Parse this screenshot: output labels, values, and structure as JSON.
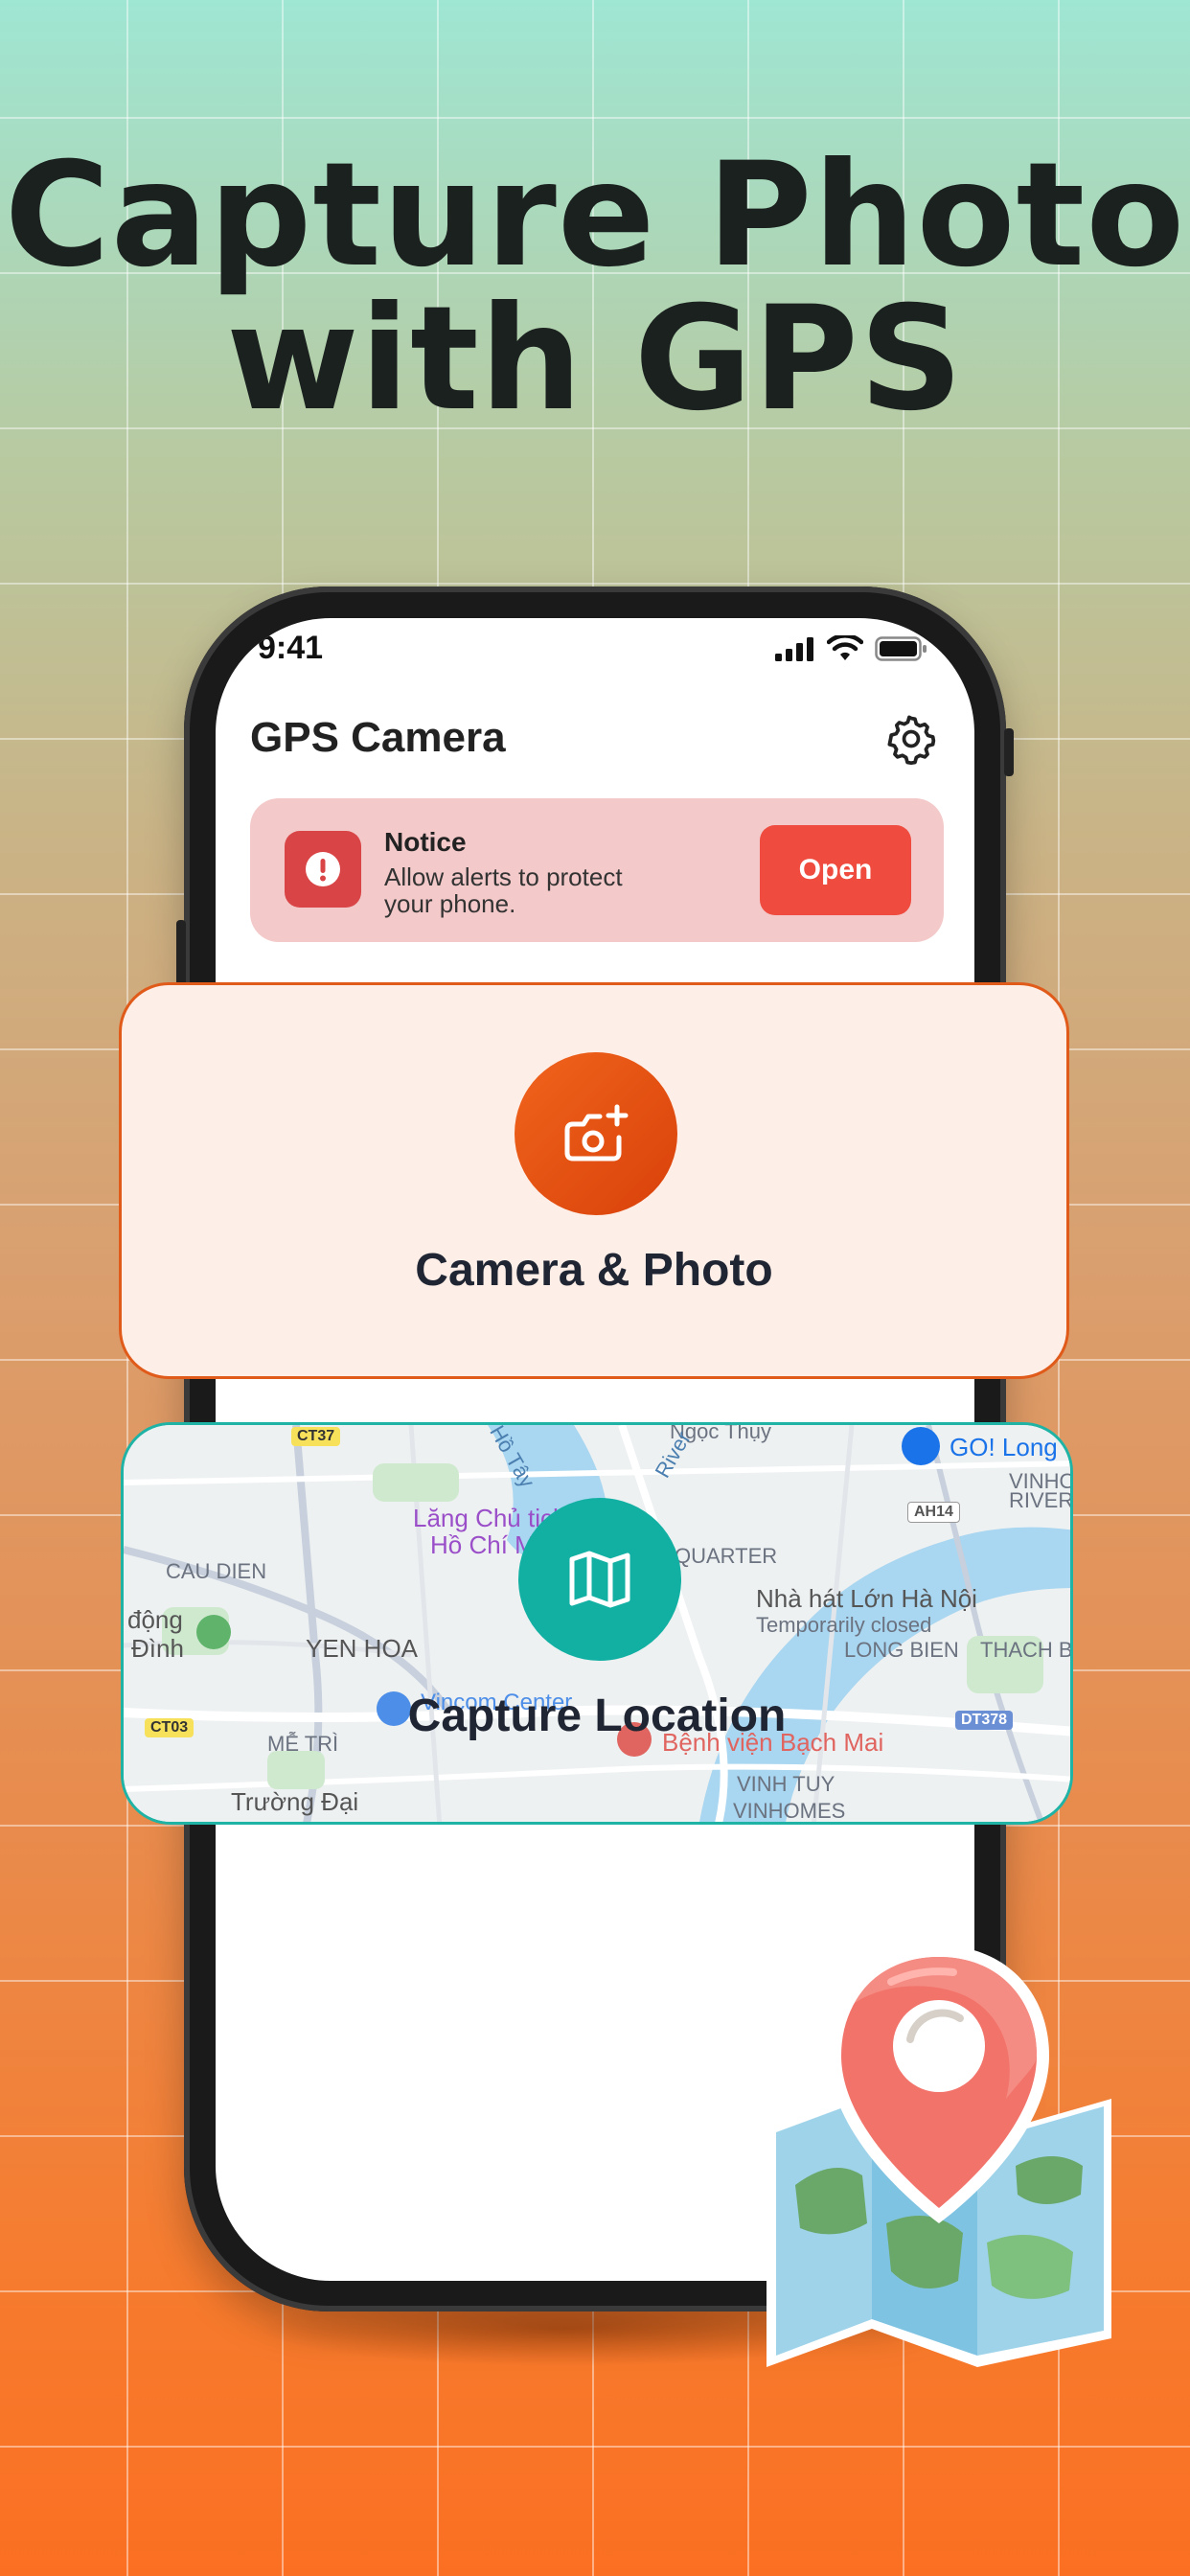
{
  "headline": {
    "line1": "Capture Photo",
    "line2": "with GPS"
  },
  "status_bar": {
    "time": "9:41"
  },
  "app": {
    "title": "GPS Camera"
  },
  "notice": {
    "title": "Notice",
    "text": "Allow alerts to protect your phone.",
    "button": "Open"
  },
  "cards": {
    "camera": {
      "label": "Camera & Photo"
    },
    "location": {
      "label": "Capture Location"
    }
  },
  "map_labels": {
    "l1": "CT37",
    "l2": "Hồ Tây",
    "l3": "Lăng Chủ tịch",
    "l4": "Hồ Chí Minh",
    "l5": "CAU DIEN",
    "l6": "động",
    "l7": "Đình",
    "l8": "YEN HOA",
    "l9": "Vincom Center",
    "l10": "MỄ TRÌ",
    "l11": "Trường Đại",
    "l12": "CT03",
    "l13": "QUARTER",
    "l14": "Nhà hát Lớn Hà Nội",
    "l15": "Temporarily closed",
    "l16": "LONG BIEN",
    "l17": "Bệnh viện Bạch Mai",
    "l18": "VINH TUY",
    "l19": "VINHOMES",
    "l20": "GO! Long",
    "l21": "AH14",
    "l22": "VINHO",
    "l23": "RIVERS",
    "l24": "THACH BA",
    "l25": "DT378",
    "l26": "Ngọc Thụy",
    "l27": "River"
  },
  "colors": {
    "accent_orange": "#e5561a",
    "accent_teal": "#12b0a3",
    "notice_bg": "#f3c9c9",
    "open_button": "#ef4b3f"
  }
}
